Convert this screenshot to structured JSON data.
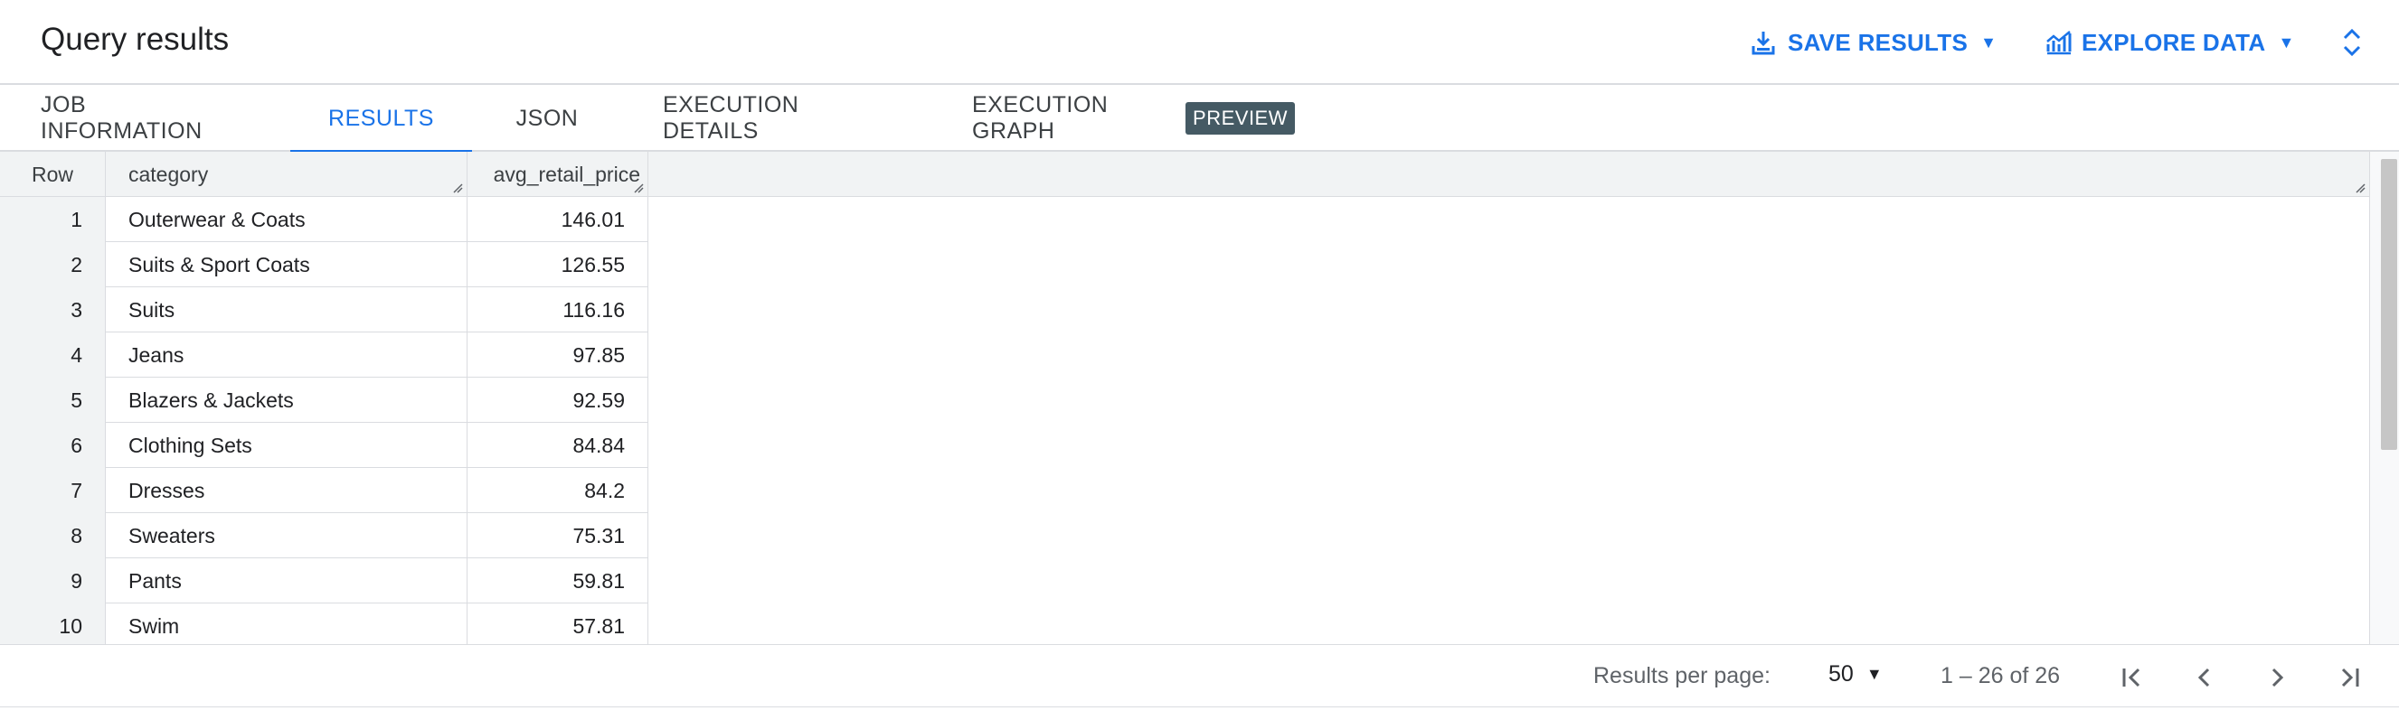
{
  "header": {
    "title": "Query results",
    "save_results": "SAVE RESULTS",
    "explore_data": "EXPLORE DATA"
  },
  "tabs": [
    {
      "label": "JOB INFORMATION"
    },
    {
      "label": "RESULTS",
      "active": true
    },
    {
      "label": "JSON"
    },
    {
      "label": "EXECUTION DETAILS"
    },
    {
      "label": "EXECUTION GRAPH",
      "badge": "PREVIEW"
    }
  ],
  "table": {
    "columns": [
      "Row",
      "category",
      "avg_retail_price"
    ],
    "rows": [
      {
        "row": "1",
        "category": "Outerwear & Coats",
        "avg_retail_price": "146.01"
      },
      {
        "row": "2",
        "category": "Suits & Sport Coats",
        "avg_retail_price": "126.55"
      },
      {
        "row": "3",
        "category": "Suits",
        "avg_retail_price": "116.16"
      },
      {
        "row": "4",
        "category": "Jeans",
        "avg_retail_price": "97.85"
      },
      {
        "row": "5",
        "category": "Blazers & Jackets",
        "avg_retail_price": "92.59"
      },
      {
        "row": "6",
        "category": "Clothing Sets",
        "avg_retail_price": "84.84"
      },
      {
        "row": "7",
        "category": "Dresses",
        "avg_retail_price": "84.2"
      },
      {
        "row": "8",
        "category": "Sweaters",
        "avg_retail_price": "75.31"
      },
      {
        "row": "9",
        "category": "Pants",
        "avg_retail_price": "59.81"
      },
      {
        "row": "10",
        "category": "Swim",
        "avg_retail_price": "57.81"
      }
    ]
  },
  "pagination": {
    "per_page_label": "Results per page:",
    "per_page_value": "50",
    "range_text": "1 – 26 of 26"
  },
  "colors": {
    "accent": "#1a73e8",
    "badge_bg": "#455a64",
    "header_bg": "#f1f3f4"
  },
  "icons": [
    "download-icon",
    "explore-chart-icon",
    "caret-down-icon",
    "expand-collapse-icon",
    "first-page-icon",
    "prev-page-icon",
    "next-page-icon",
    "last-page-icon"
  ]
}
